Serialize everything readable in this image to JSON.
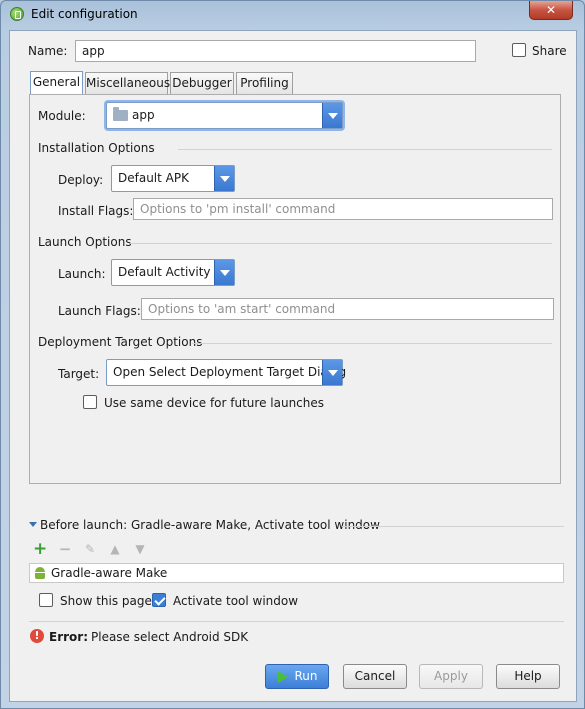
{
  "window": {
    "title": "Edit configuration",
    "close_glyph": "✕"
  },
  "name": {
    "label": "Name:",
    "value": "app"
  },
  "share": {
    "label": "Share",
    "checked": false
  },
  "tabs": [
    {
      "label": "General",
      "active": true
    },
    {
      "label": "Miscellaneous",
      "active": false
    },
    {
      "label": "Debugger",
      "active": false
    },
    {
      "label": "Profiling",
      "active": false
    }
  ],
  "general": {
    "module": {
      "label": "Module:",
      "value": "app"
    },
    "installation": {
      "title": "Installation Options",
      "deploy_label": "Deploy:",
      "deploy_value": "Default APK",
      "install_flags_label": "Install Flags:",
      "install_flags_placeholder": "Options to 'pm install' command"
    },
    "launch": {
      "title": "Launch Options",
      "launch_label": "Launch:",
      "launch_value": "Default Activity",
      "launch_flags_label": "Launch Flags:",
      "launch_flags_placeholder": "Options to 'am start' command"
    },
    "deployment_target": {
      "title": "Deployment Target Options",
      "target_label": "Target:",
      "target_value": "Open Select Deployment Target Dialog",
      "same_device_label": "Use same device for future launches",
      "same_device_checked": false
    }
  },
  "before_launch": {
    "title": "Before launch: Gradle-aware Make, Activate tool window",
    "toolbar_icons": [
      "add-icon",
      "remove-icon",
      "edit-icon",
      "move-up-icon",
      "move-down-icon"
    ],
    "items": [
      {
        "label": "Gradle-aware Make"
      }
    ],
    "show_this_page_label": "Show this page",
    "show_this_page_checked": false,
    "activate_tool_window_label": "Activate tool window",
    "activate_tool_window_checked": true
  },
  "error": {
    "prefix": "Error:",
    "message": "Please select Android SDK"
  },
  "buttons": {
    "run": "Run",
    "cancel": "Cancel",
    "apply": "Apply",
    "help": "Help"
  },
  "colors": {
    "accent": "#3c7fd8",
    "error": "#e04a3a",
    "add": "#3aa02f"
  }
}
